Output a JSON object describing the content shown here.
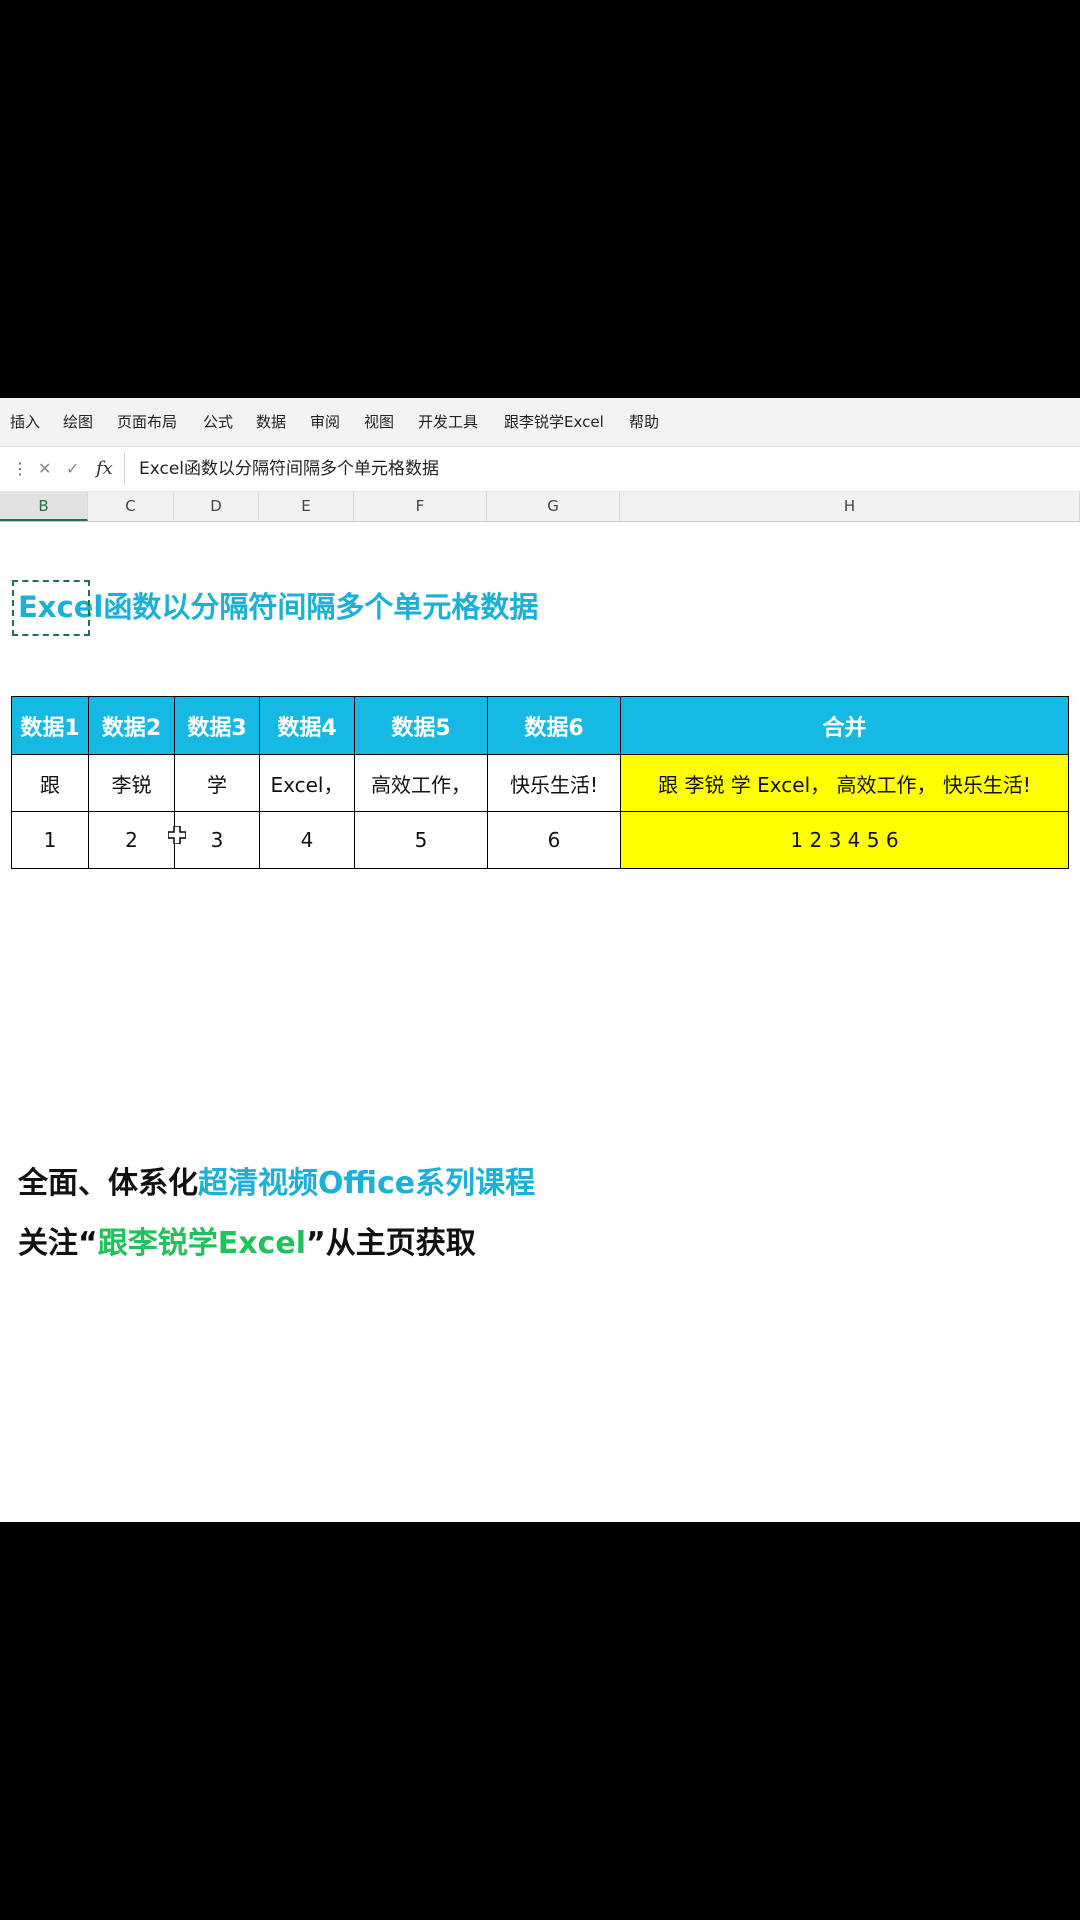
{
  "menu": [
    "插入",
    "绘图",
    "页面布局",
    "公式",
    "数据",
    "审阅",
    "视图",
    "开发工具",
    "跟李锐学Excel",
    "帮助"
  ],
  "formula_bar": {
    "icons": [
      "dots-icon",
      "cancel-icon",
      "confirm-icon",
      "fx-icon"
    ],
    "fx_label": "fx",
    "value": "Excel函数以分隔符间隔多个单元格数据"
  },
  "columns": [
    "B",
    "C",
    "D",
    "E",
    "F",
    "G",
    "H"
  ],
  "selected_column": "B",
  "sheet": {
    "title": "Excel函数以分隔符间隔多个单元格数据",
    "headers": [
      "数据1",
      "数据2",
      "数据3",
      "数据4",
      "数据5",
      "数据6",
      "合并"
    ],
    "rows": [
      [
        "跟",
        "李锐",
        "学",
        "Excel，",
        "高效工作，",
        "快乐生活!",
        "跟 李锐 学 Excel， 高效工作， 快乐生活!"
      ],
      [
        "1",
        "2",
        "3",
        "4",
        "5",
        "6",
        "1 2 3 4 5 6"
      ]
    ],
    "header_color": "#16b9e4",
    "highlight_color": "#ffff00"
  },
  "promo": {
    "line1_a": "全面、体系化",
    "line1_b": "超清视频Office系列课程",
    "line2_a": "关注“",
    "line2_b": "跟李锐学Excel",
    "line2_c": "”从主页获取"
  }
}
